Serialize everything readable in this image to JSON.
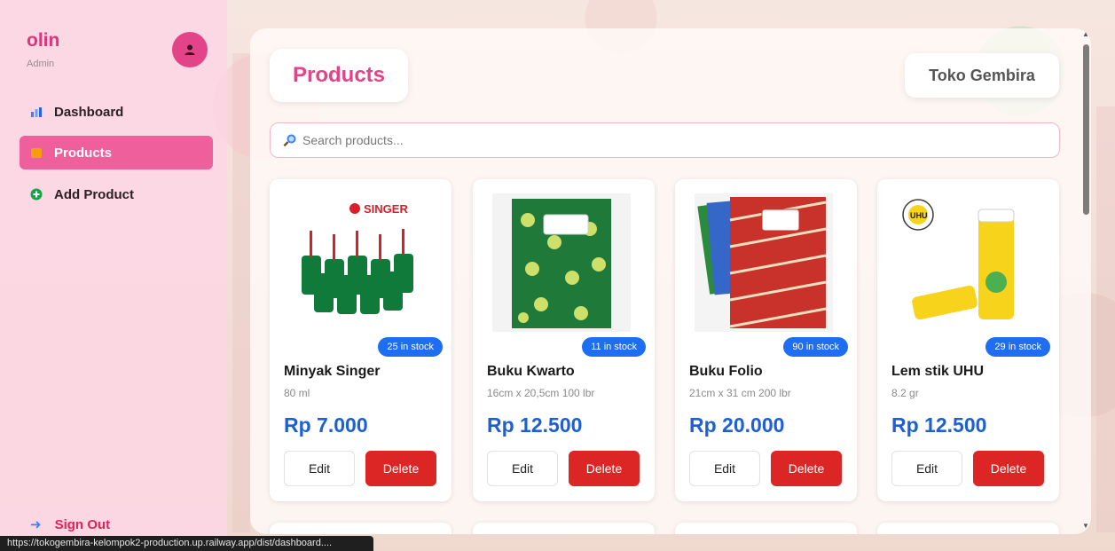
{
  "user": {
    "name": "olin",
    "role": "Admin"
  },
  "sidebar": {
    "items": [
      {
        "label": "Dashboard",
        "icon": "chart-icon",
        "active": false
      },
      {
        "label": "Products",
        "icon": "box-icon",
        "active": true
      },
      {
        "label": "Add Product",
        "icon": "plus-circle-icon",
        "active": false
      }
    ],
    "signout_label": "Sign Out"
  },
  "page": {
    "title": "Products",
    "store_name": "Toko Gembira",
    "search_placeholder": "Search products..."
  },
  "products": [
    {
      "name": "Minyak Singer",
      "desc": "80 ml",
      "price": "Rp 7.000",
      "stock": "25 in stock",
      "image": "singer-oil-bottles",
      "image_text": "SINGER"
    },
    {
      "name": "Buku Kwarto",
      "desc": "16cm x 20,5cm 100 lbr",
      "price": "Rp 12.500",
      "stock": "11 in stock",
      "image": "green-notebook"
    },
    {
      "name": "Buku Folio",
      "desc": "21cm x 31 cm 200 lbr",
      "price": "Rp 20.000",
      "stock": "90 in stock",
      "image": "batik-notebooks"
    },
    {
      "name": "Lem stik UHU",
      "desc": "8.2 gr",
      "price": "Rp 12.500",
      "stock": "29 in stock",
      "image": "uhu-glue-stick",
      "image_text": "UHU"
    }
  ],
  "buttons": {
    "edit": "Edit",
    "delete": "Delete"
  },
  "statusbar": {
    "url": "https://tokogembira-kelompok2-production.up.railway.app/dist/dashboard...."
  },
  "colors": {
    "accent": "#e2448a",
    "price": "#1d5fd6",
    "badge": "#1d6ef2",
    "delete": "#dc2626",
    "sidebar": "#fcd6e4"
  }
}
